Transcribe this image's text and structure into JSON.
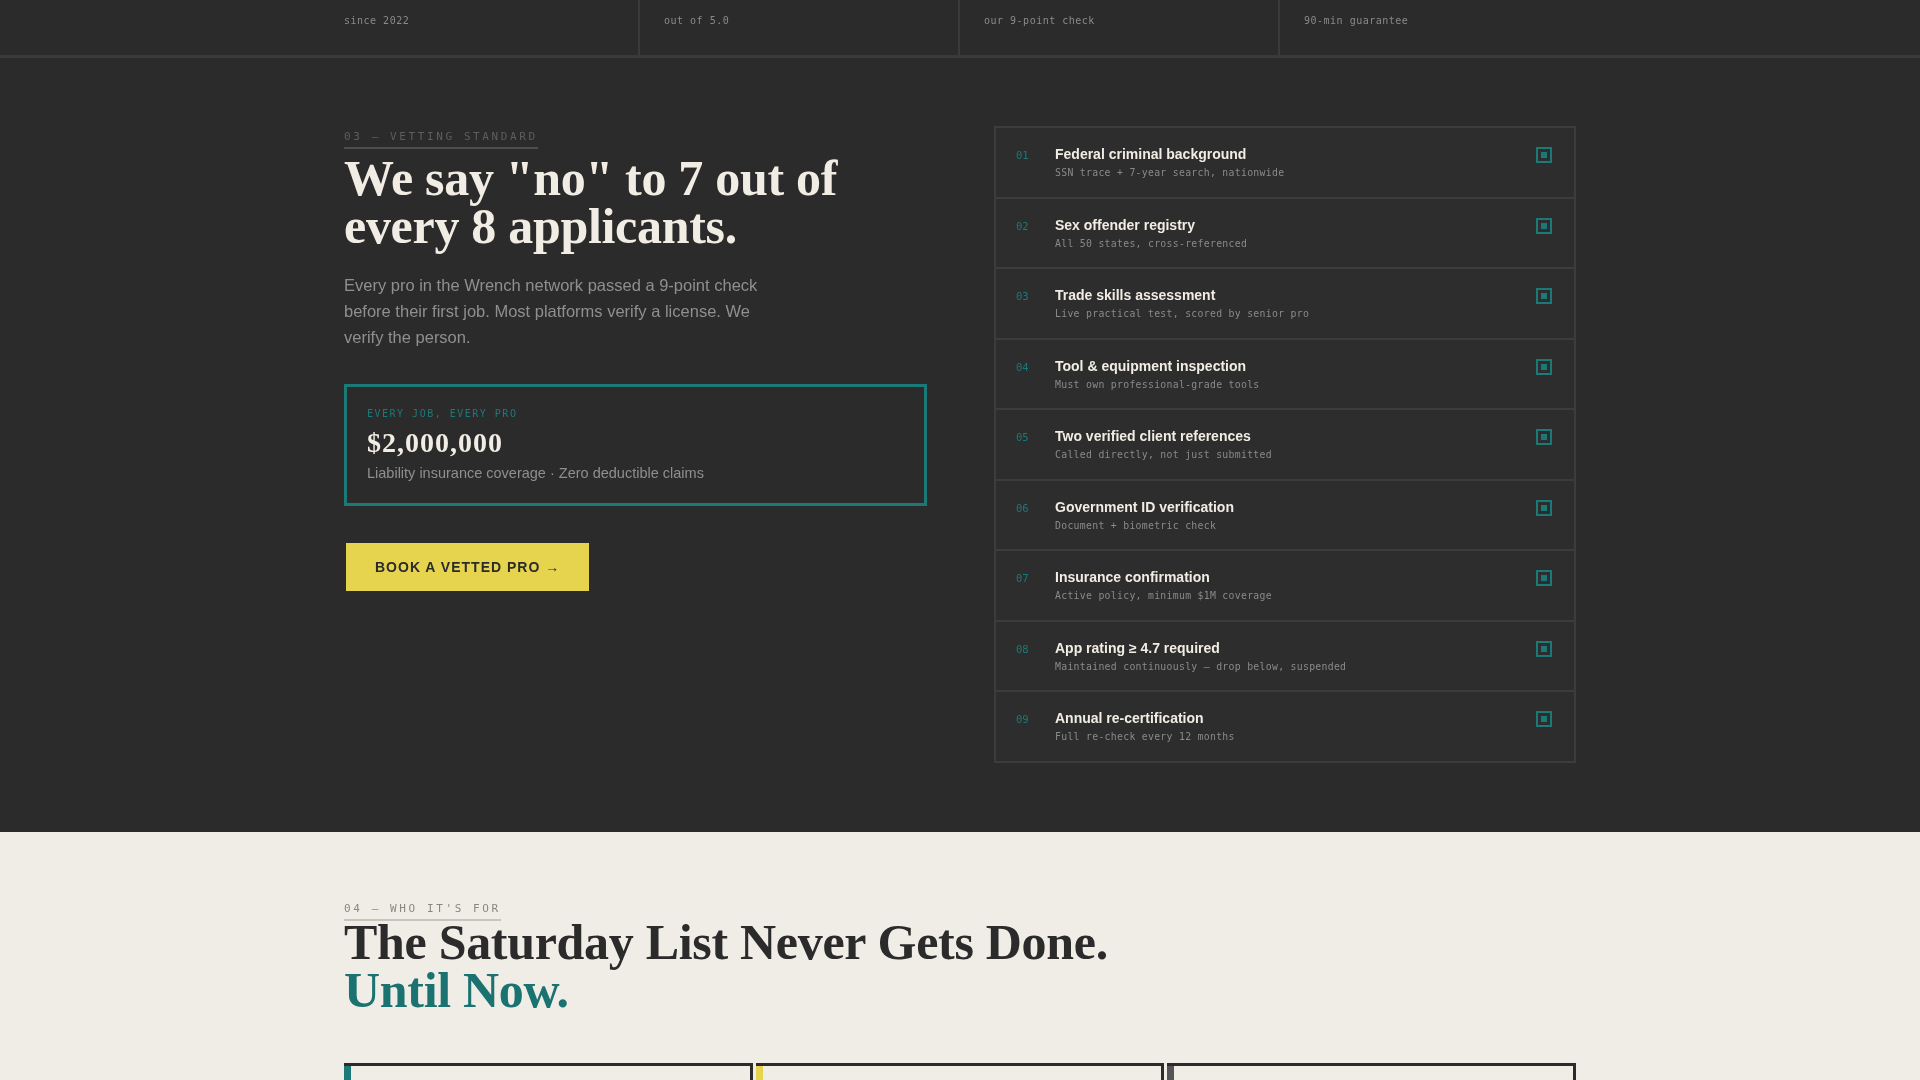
{
  "stats_strip": [
    {
      "caption": "since 2022"
    },
    {
      "caption": "out of 5.0"
    },
    {
      "caption": "our 9-point check"
    },
    {
      "caption": "90-min guarantee"
    }
  ],
  "vetting": {
    "eyebrow": "03 — VETTING STANDARD",
    "heading": "We say \"no\" to 7 out of every 8 applicants.",
    "body": "Every pro in the Wrench network passed a 9-point check before their first job. Most platforms verify a license. We verify the person.",
    "insurance": {
      "eyebrow": "EVERY JOB, EVERY PRO",
      "amount": "$2,000,000",
      "caption": "Liability insurance coverage · Zero deductible claims"
    },
    "cta": "BOOK A VETTED PRO →",
    "checks": [
      {
        "number": "01",
        "title": "Federal criminal background",
        "detail": "SSN trace + 7-year search, nationwide",
        "checked": true
      },
      {
        "number": "02",
        "title": "Sex offender registry",
        "detail": "All 50 states, cross-referenced",
        "checked": true
      },
      {
        "number": "03",
        "title": "Trade skills assessment",
        "detail": "Live practical test, scored by senior pro",
        "checked": true
      },
      {
        "number": "04",
        "title": "Tool & equipment inspection",
        "detail": "Must own professional-grade tools",
        "checked": true
      },
      {
        "number": "05",
        "title": "Two verified client references",
        "detail": "Called directly, not just submitted",
        "checked": true
      },
      {
        "number": "06",
        "title": "Government ID verification",
        "detail": "Document + biometric check",
        "checked": true
      },
      {
        "number": "07",
        "title": "Insurance confirmation",
        "detail": "Active policy, minimum $1M coverage",
        "checked": true
      },
      {
        "number": "08",
        "title": "App rating ≥ 4.7 required",
        "detail": "Maintained continuously — drop below, suspended",
        "checked": true
      },
      {
        "number": "09",
        "title": "Annual re-certification",
        "detail": "Full re-check every 12 months",
        "checked": true
      }
    ]
  },
  "audience": {
    "eyebrow": "04 — WHO IT'S FOR",
    "heading": "The Saturday List Never Gets Done.",
    "heading_accent": "Until Now.",
    "cards": [
      {
        "color": "#1b7a78"
      },
      {
        "color": "#e6d44e"
      },
      {
        "color": "#555555"
      }
    ]
  }
}
